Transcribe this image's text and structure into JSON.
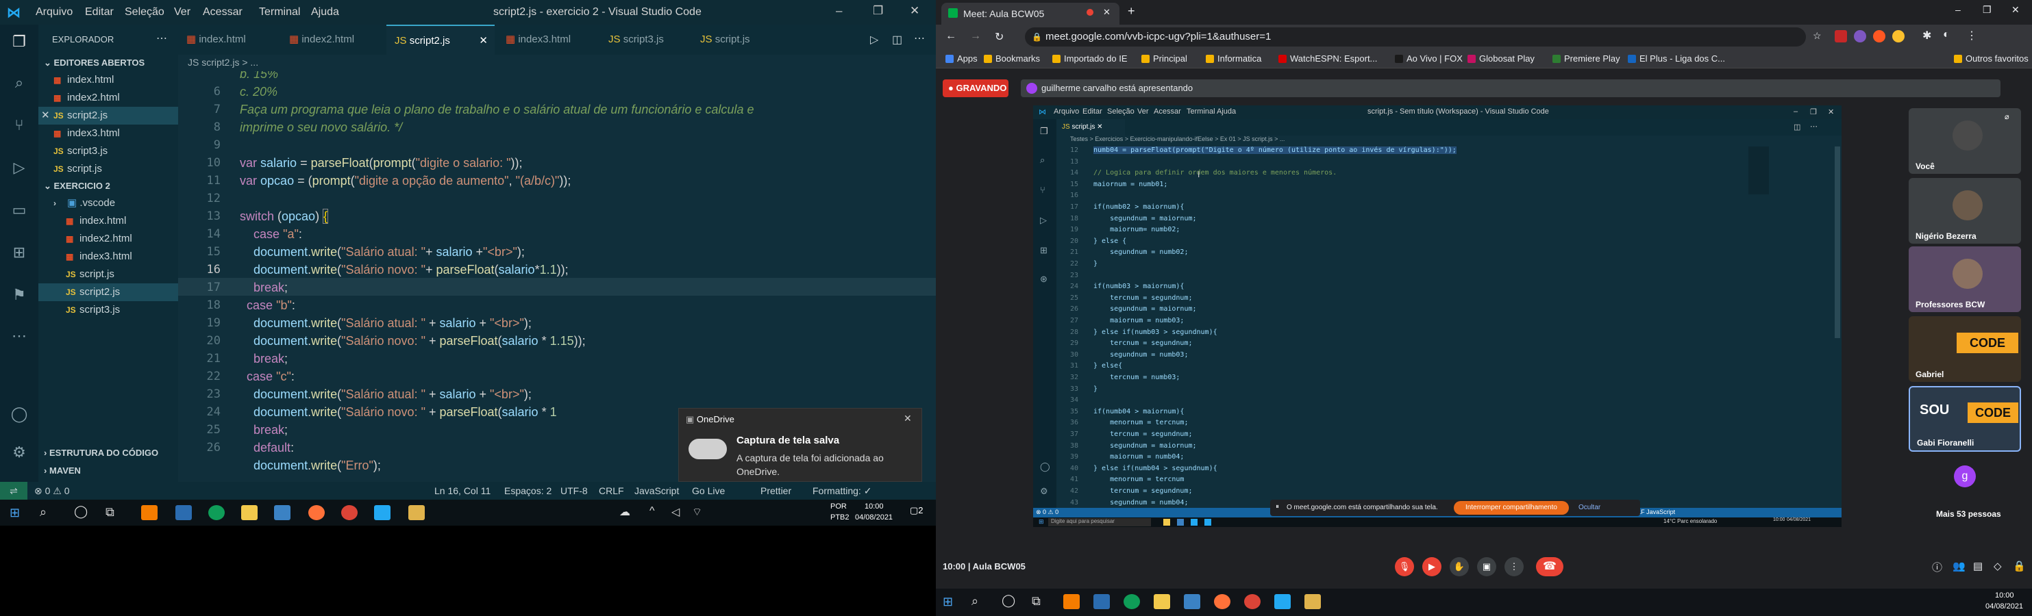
{
  "vscode": {
    "menu": [
      "Arquivo",
      "Editar",
      "Seleção",
      "Ver",
      "Acessar",
      "Terminal",
      "Ajuda"
    ],
    "title": "script2.js - exercicio 2 - Visual Studio Code",
    "sidebar_title": "EXPLORADOR",
    "open_editors_title": "EDITORES ABERTOS",
    "open_editors": [
      "index.html",
      "index2.html",
      "script2.js",
      "index3.html",
      "script3.js",
      "script.js"
    ],
    "workspace_title": "EXERCICIO 2",
    "workspace_files": [
      ".vscode",
      "index.html",
      "index2.html",
      "index3.html",
      "script.js",
      "script2.js",
      "script3.js"
    ],
    "outline_title": "ESTRUTURA DO CÓDIGO",
    "maven_title": "MAVEN",
    "tabs": [
      "index.html",
      "index2.html",
      "script2.js",
      "index3.html",
      "script3.js",
      "script.js"
    ],
    "breadcrumb": "JS script2.js > ...",
    "line_numbers": [
      "",
      "6",
      "7",
      "8",
      "9",
      "10",
      "11",
      "12",
      "13",
      "14",
      "15",
      "16",
      "17",
      "18",
      "19",
      "20",
      "21",
      "22",
      "23",
      "24",
      "25",
      "26"
    ],
    "status": {
      "errors": "⊗ 0 ⚠ 0",
      "position": "Ln 16, Col 11",
      "spaces": "Espaços: 2",
      "encoding": "UTF-8",
      "eol": "CRLF",
      "language": "JavaScript",
      "golive": "Go Live",
      "prettier": "Prettier",
      "formatting": "Formatting: ✓"
    },
    "toast": {
      "app": "OneDrive",
      "title": "Captura de tela salva",
      "body": "A captura de tela foi adicionada ao OneDrive."
    },
    "taskbar": {
      "lang": "POR",
      "kbd": "PTB2",
      "time": "10:00",
      "date": "04/08/2021",
      "notif": "2"
    }
  },
  "chrome": {
    "tab_title": "Meet: Aula BCW05",
    "url": "meet.google.com/vvb-icpc-ugv?pli=1&authuser=1",
    "bookmarks": [
      "Apps",
      "Bookmarks",
      "Importado do IE",
      "Principal",
      "Informatica",
      "WatchESPN: Esport...",
      "Ao Vivo | FOX",
      "Globosat Play",
      "Premiere Play",
      "El Plus - Liga dos C...",
      "Outros favoritos"
    ],
    "bookmark_colors": [
      "#4285f4",
      "#f4b400",
      "#f4b400",
      "#f4b400",
      "#f4b400",
      "#d50000",
      "#1a1a1a",
      "#c51162",
      "#2e7d32",
      "#1565c0",
      "#f4b400"
    ]
  },
  "meet": {
    "recording": "GRAVANDO",
    "presenting": "guilherme carvalho está apresentando",
    "meeting_name": "10:00 | Aula BCW05",
    "share_notice": "O meet.google.com está compartilhando sua tela.",
    "stop_share": "Interromper compartilhamento",
    "hide": "Ocultar",
    "participants": [
      "Você",
      "Nigério Bezerra",
      "Professores BCW",
      "Gabriel",
      "Gabi Fioranelli",
      "Mais 53 pessoas"
    ],
    "others_badge": "g",
    "inner": {
      "menu": [
        "Arquivo",
        "Editar",
        "Seleção",
        "Ver",
        "Acessar",
        "Terminal",
        "Ajuda"
      ],
      "title": "script.js - Sem título (Workspace) - Visual Studio Code",
      "tab": "script.js",
      "breadcrumb": "Testes > Exercicios > Exercicio-manipulando-ifEelse > Ex 01 > JS script.js > ...",
      "lines": [
        "12",
        "13",
        "14",
        "15",
        "16",
        "17",
        "18",
        "19",
        "20",
        "21",
        "22",
        "23",
        "24",
        "25",
        "26",
        "27",
        "28",
        "29",
        "30",
        "31",
        "32",
        "33",
        "34",
        "35",
        "36",
        "37",
        "38",
        "39",
        "40",
        "41",
        "42",
        "43"
      ],
      "code": [
        "numb04 = parseFloat(prompt(\"Digite o 4º número (utilize ponto ao invés de vírgulas):\"));",
        "",
        "// Logica para definir ordem dos maiores e menores números.",
        "maiornum = numb01;",
        "",
        "if(numb02 > maiornum){",
        "    segundnum = maiornum;",
        "    maiornum= numb02;",
        "} else {",
        "    segundnum = numb02;",
        "}",
        "",
        "if(numb03 > maiornum){",
        "    tercnum = segundnum;",
        "    segundnum = maiornum;",
        "    maiornum = numb03;",
        "} else if(numb03 > segundnum){",
        "    tercnum = segundnum;",
        "    segundnum = numb03;",
        "} else{",
        "    tercnum = numb03;",
        "}",
        "",
        "if(numb04 > maiornum){",
        "    menornum = tercnum;",
        "    tercnum = segundnum;",
        "    segundnum = maiornum;",
        "    maiornum = numb04;",
        "} else if(numb04 > segundnum){",
        "    menornum = tercnum",
        "    tercnum = segundnum;",
        "    segundnum = numb04;"
      ],
      "status": "(252 selecionado)   Espaços: 4   UTF-8   CRLF   JavaScript",
      "search": "Digite aqui para pesquisar",
      "weather": "14°C  Parc ensolarado",
      "time": "10:00",
      "date": "04/08/2021"
    },
    "taskbar_time": "10:00",
    "taskbar_date": "04/08/2021"
  }
}
